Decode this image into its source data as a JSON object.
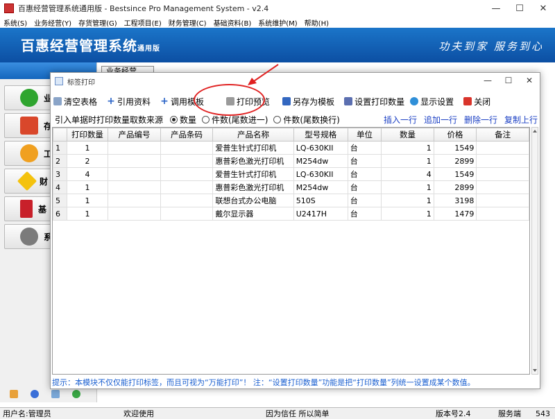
{
  "window": {
    "title": "百惠经营管理系统通用版 - Bestsince Pro Management System - v2.4"
  },
  "menu": [
    "系统(S)",
    "业务经营(Y)",
    "存货管理(G)",
    "工程项目(E)",
    "财务管理(C)",
    "基础资料(B)",
    "系统维护(M)",
    "帮助(H)"
  ],
  "banner": {
    "brand": "百惠经营管理系统",
    "edition": "通用版",
    "slogan": "功夫到家 服务到心"
  },
  "left_nav": [
    {
      "label": "业",
      "icon": "check-icon"
    },
    {
      "label": "存",
      "icon": "home-icon"
    },
    {
      "label": "工",
      "icon": "sync-icon"
    },
    {
      "label": "财",
      "icon": "star-icon"
    },
    {
      "label": "基",
      "icon": "book-icon"
    },
    {
      "label": "系",
      "icon": "gear-icon"
    }
  ],
  "bg_tab": "业务经营",
  "dialog": {
    "title": "标签打印",
    "toolbar": [
      {
        "label": "清空表格",
        "icon": "brush-icon"
      },
      {
        "label": "引用资料",
        "icon": "plus-icon"
      },
      {
        "label": "调用模板",
        "icon": "plus-icon"
      },
      {
        "label": "打印预览",
        "icon": "printer-icon"
      },
      {
        "label": "另存为模板",
        "icon": "save-icon"
      },
      {
        "label": "设置打印数量",
        "icon": "settings-icon"
      },
      {
        "label": "显示设置",
        "icon": "display-icon"
      },
      {
        "label": "关闭",
        "icon": "close-icon"
      }
    ],
    "source_label": "引入单据时打印数量取数来源",
    "options": [
      {
        "label": "数量",
        "selected": true
      },
      {
        "label": "件数(尾数进一)",
        "selected": false
      },
      {
        "label": "件数(尾数换行)",
        "selected": false
      }
    ],
    "row_actions": [
      "插入一行",
      "追加一行",
      "删除一行",
      "复制上行"
    ],
    "columns": [
      "",
      "打印数量",
      "产品编号",
      "产品条码",
      "产品名称",
      "型号规格",
      "单位",
      "数量",
      "价格",
      "备注"
    ],
    "rows": [
      {
        "no": "1",
        "print_qty": "1",
        "code": "",
        "barcode": "",
        "name": "爱普生针式打印机",
        "model": "LQ-630KII",
        "unit": "台",
        "qty": "1",
        "price": "1549",
        "note": ""
      },
      {
        "no": "2",
        "print_qty": "2",
        "code": "",
        "barcode": "",
        "name": "惠普彩色激光打印机",
        "model": "M254dw",
        "unit": "台",
        "qty": "1",
        "price": "2899",
        "note": ""
      },
      {
        "no": "3",
        "print_qty": "4",
        "code": "",
        "barcode": "",
        "name": "爱普生针式打印机",
        "model": "LQ-630KII",
        "unit": "台",
        "qty": "4",
        "price": "1549",
        "note": ""
      },
      {
        "no": "4",
        "print_qty": "1",
        "code": "",
        "barcode": "",
        "name": "惠普彩色激光打印机",
        "model": "M254dw",
        "unit": "台",
        "qty": "1",
        "price": "2899",
        "note": ""
      },
      {
        "no": "5",
        "print_qty": "1",
        "code": "",
        "barcode": "",
        "name": "联想台式办公电脑",
        "model": "510S",
        "unit": "台",
        "qty": "1",
        "price": "3198",
        "note": ""
      },
      {
        "no": "6",
        "print_qty": "1",
        "code": "",
        "barcode": "",
        "name": "戴尔显示器",
        "model": "U2417H",
        "unit": "台",
        "qty": "1",
        "price": "1479",
        "note": ""
      }
    ],
    "tip": "提示：本模块不仅仅能打印标签，而且可视为“万能打印”！ 注：“设置打印数量”功能是把“打印数量”列统一设置成某个数值。"
  },
  "status": {
    "user": "用户名:管理员",
    "welcome": "欢迎使用",
    "motto": "因为信任 所以简单",
    "version": "版本号2.4",
    "server": "服务端",
    "port": "543"
  },
  "colors": {
    "banner": "#0c4fa3",
    "accent_red": "#e02020",
    "link_blue": "#1a3fc4"
  }
}
